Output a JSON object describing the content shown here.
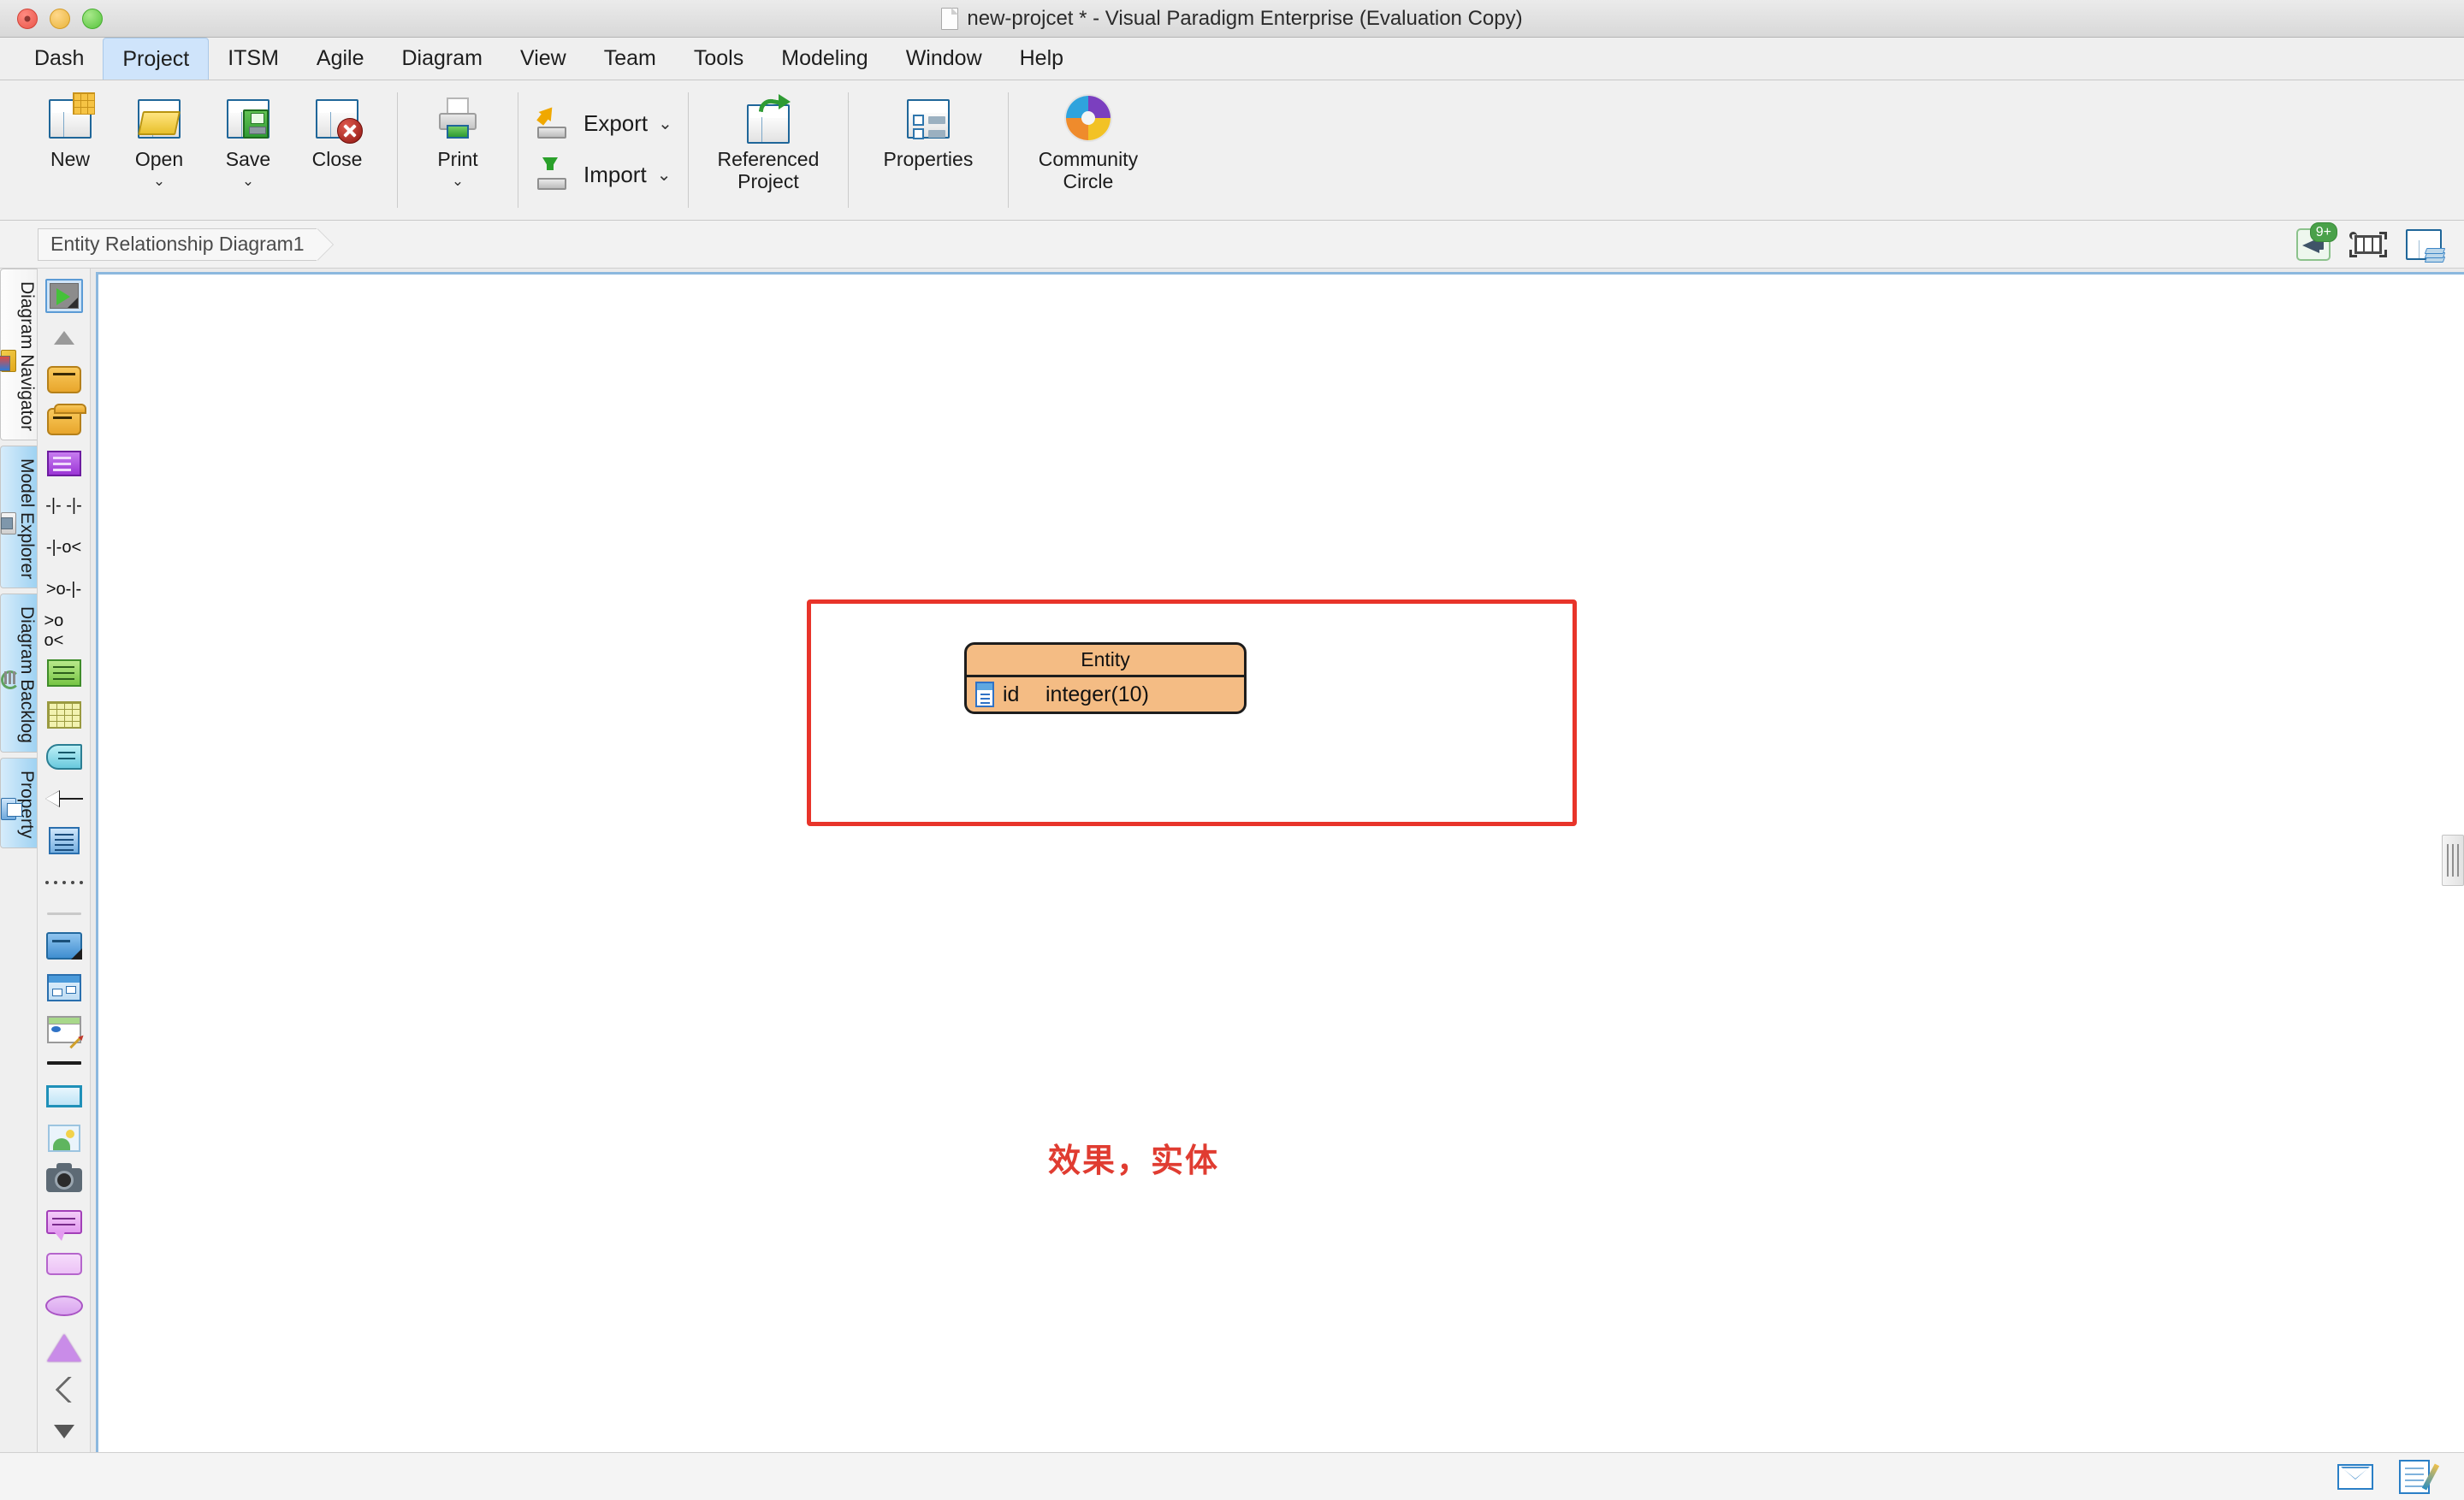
{
  "window": {
    "title": "new-projcet * - Visual Paradigm Enterprise (Evaluation Copy)",
    "traffic_lights": [
      "close",
      "minimize",
      "maximize"
    ]
  },
  "menubar": {
    "items": [
      {
        "label": "Dash",
        "active": false
      },
      {
        "label": "Project",
        "active": true
      },
      {
        "label": "ITSM",
        "active": false
      },
      {
        "label": "Agile",
        "active": false
      },
      {
        "label": "Diagram",
        "active": false
      },
      {
        "label": "View",
        "active": false
      },
      {
        "label": "Team",
        "active": false
      },
      {
        "label": "Tools",
        "active": false
      },
      {
        "label": "Modeling",
        "active": false
      },
      {
        "label": "Window",
        "active": false
      },
      {
        "label": "Help",
        "active": false
      }
    ]
  },
  "ribbon": {
    "new_label": "New",
    "open_label": "Open",
    "save_label": "Save",
    "close_label": "Close",
    "print_label": "Print",
    "export_label": "Export",
    "import_label": "Import",
    "referenced_project_label": "Referenced Project",
    "properties_label": "Properties",
    "community_circle_label": "Community Circle",
    "caret": "⌄",
    "chevron": "⌄"
  },
  "breadcrumb": {
    "items": [
      "Entity Relationship Diagram1"
    ],
    "notification_badge": "9+"
  },
  "sidebar": {
    "tabs": [
      {
        "label": "Diagram Navigator",
        "icon": "diagram-navigator-icon",
        "selected": true
      },
      {
        "label": "Model Explorer",
        "icon": "model-explorer-icon",
        "selected": false
      },
      {
        "label": "Diagram Backlog",
        "icon": "diagram-backlog-icon",
        "selected": false
      },
      {
        "label": "Property",
        "icon": "property-icon",
        "selected": false
      }
    ]
  },
  "palette": {
    "tools": [
      {
        "name": "pointer-tool",
        "icon": "pointer-icon",
        "selected": true
      },
      {
        "name": "resize-tool",
        "icon": "triangle-up-icon"
      },
      {
        "name": "entity-tool",
        "icon": "entity-icon"
      },
      {
        "name": "view-tool",
        "icon": "entity-stack-icon"
      },
      {
        "name": "note-tool",
        "icon": "purple-note-icon"
      },
      {
        "name": "relationship-one-to-one",
        "icon": "relationship-1-1-icon",
        "glyph": "-|- -|-"
      },
      {
        "name": "relationship-one-to-many",
        "icon": "relationship-1-n-icon",
        "glyph": "-|-o<"
      },
      {
        "name": "relationship-many-to-one",
        "icon": "relationship-n-1-icon",
        "glyph": ">o-|-"
      },
      {
        "name": "relationship-many-to-many",
        "icon": "relationship-n-n-icon",
        "glyph": ">o o<"
      },
      {
        "name": "green-table-tool",
        "icon": "green-table-icon"
      },
      {
        "name": "yellow-grid-tool",
        "icon": "yellow-grid-icon"
      },
      {
        "name": "cyan-note-tool",
        "icon": "cyan-note-icon"
      },
      {
        "name": "anchor-tool",
        "icon": "arrow-left-icon"
      },
      {
        "name": "document-tool",
        "icon": "blue-document-icon"
      },
      {
        "name": "dotted-line-tool",
        "icon": "dotted-line-icon"
      },
      {
        "name": "palette-divider-1",
        "icon": "divider-icon"
      },
      {
        "name": "folder-tool",
        "icon": "blue-folder-icon"
      },
      {
        "name": "sub-diagram-tool",
        "icon": "sub-diagram-icon"
      },
      {
        "name": "table-record-editor-tool",
        "icon": "table-edit-icon"
      },
      {
        "name": "palette-divider-2",
        "icon": "black-line-icon"
      },
      {
        "name": "rectangle-tool",
        "icon": "cyan-rectangle-icon"
      },
      {
        "name": "image-tool",
        "icon": "image-icon"
      },
      {
        "name": "screenshot-tool",
        "icon": "camera-icon"
      },
      {
        "name": "callout-tool",
        "icon": "speech-bubble-icon"
      },
      {
        "name": "rounded-rectangle-tool",
        "icon": "rounded-rectangle-icon"
      },
      {
        "name": "ellipse-tool",
        "icon": "ellipse-icon"
      },
      {
        "name": "triangle-tool",
        "icon": "triangle-icon"
      },
      {
        "name": "zigzag-line-tool",
        "icon": "zigzag-icon"
      },
      {
        "name": "more-tools",
        "icon": "triangle-down-icon"
      }
    ]
  },
  "canvas": {
    "entity": {
      "name": "Entity",
      "columns": [
        {
          "icon": "column-icon",
          "name": "id",
          "type": "integer(10)"
        }
      ],
      "fill_color": "#f4bc84",
      "border_color": "#1d1d1d"
    },
    "selection_rect_color": "#e8342a",
    "annotation": {
      "text": "效果，实体",
      "color": "#e03c31"
    }
  },
  "statusbar": {
    "icons": [
      "mail-icon",
      "note-edit-icon"
    ]
  }
}
